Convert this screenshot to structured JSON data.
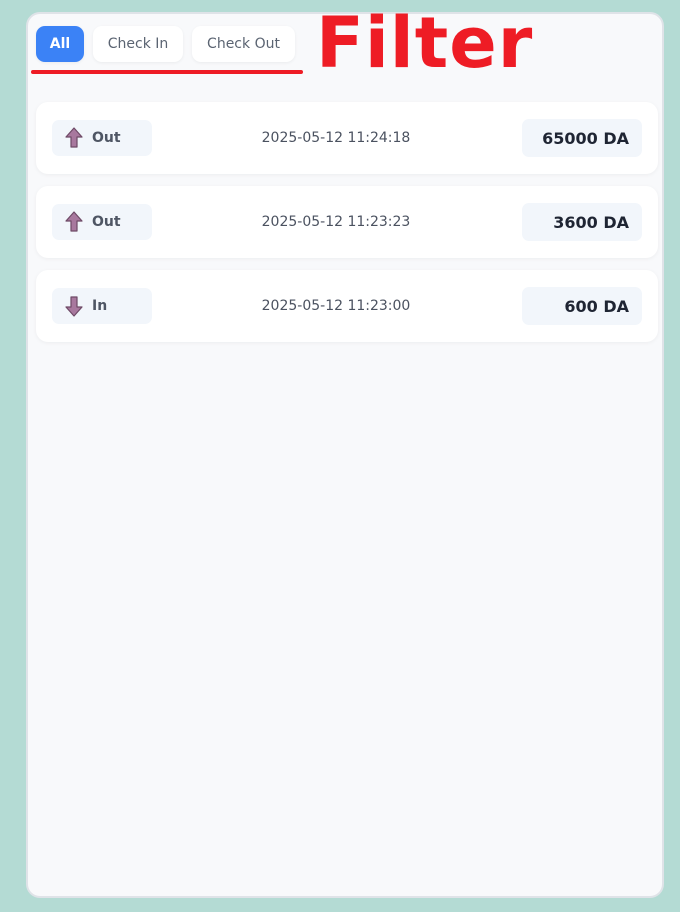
{
  "filters": {
    "tabs": [
      {
        "label": "All",
        "active": true
      },
      {
        "label": "Check In",
        "active": false
      },
      {
        "label": "Check Out",
        "active": false
      }
    ]
  },
  "annotation": {
    "text": "Filter",
    "color": "#ee1c25"
  },
  "transactions": [
    {
      "type": "Out",
      "direction_icon": "up-arrow-icon",
      "timestamp": "2025-05-12 11:24:18",
      "amount": "65000 DA"
    },
    {
      "type": "Out",
      "direction_icon": "up-arrow-icon",
      "timestamp": "2025-05-12 11:23:23",
      "amount": "3600 DA"
    },
    {
      "type": "In",
      "direction_icon": "down-arrow-icon",
      "timestamp": "2025-05-12 11:23:00",
      "amount": "600 DA"
    }
  ],
  "colors": {
    "accent": "#3b82f6",
    "arrow": "#a8789e",
    "background": "#b4dbd4"
  }
}
